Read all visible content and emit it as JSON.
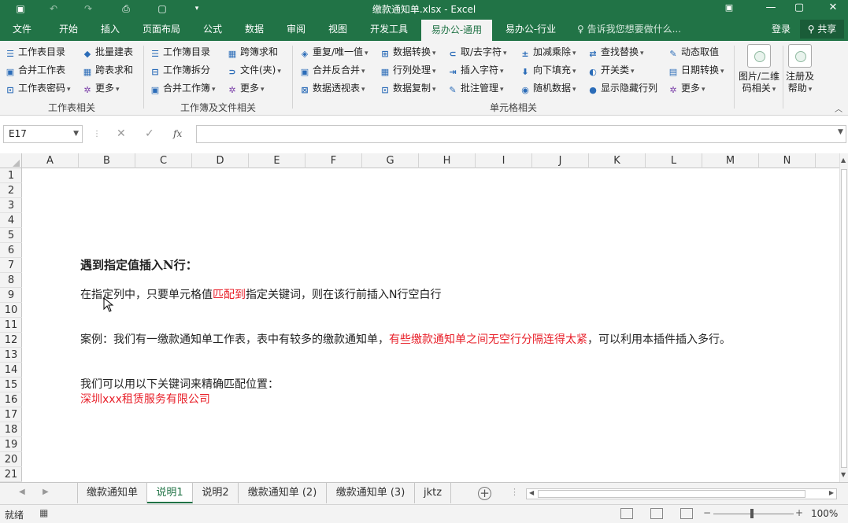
{
  "window": {
    "title": "缴款通知单.xlsx - Excel"
  },
  "tabs": [
    {
      "label": "文件"
    },
    {
      "label": "开始"
    },
    {
      "label": "插入"
    },
    {
      "label": "页面布局"
    },
    {
      "label": "公式"
    },
    {
      "label": "数据"
    },
    {
      "label": "审阅"
    },
    {
      "label": "视图"
    },
    {
      "label": "开发工具"
    },
    {
      "label": "易办公-通用"
    },
    {
      "label": "易办公-行业"
    }
  ],
  "tell_me": "告诉我您想要做什么...",
  "account": {
    "login": "登录",
    "share": "共享"
  },
  "ribbon": {
    "groups": {
      "sheet": "工作表相关",
      "workbook": "工作簿及文件相关",
      "cell": "单元格相关"
    },
    "b": {
      "sheet_list": "工作表目录",
      "batch_create": "批量建表",
      "merge_sheet": "合并工作表",
      "cross_sum": "跨表求和",
      "sheet_pwd": "工作表密码",
      "more1": "更多",
      "wb_list": "工作簿目录",
      "wb_cross_sum": "跨簿求和",
      "wb_split": "工作簿拆分",
      "file_folder": "文件(夹)",
      "merge_wb": "合并工作簿",
      "more2": "更多",
      "dup_unique": "重复/唯一值",
      "data_convert": "数据转换",
      "get_remove_char": "取/去字符",
      "add_sub_mul_div": "加减乘除",
      "find_replace": "查找替换",
      "dynamic_value": "动态取值",
      "merge_unmerge": "合并反合并",
      "row_col": "行列处理",
      "insert_char": "插入字符",
      "fill_down": "向下填充",
      "switch": "开关类",
      "date_convert": "日期转换",
      "pivot": "数据透视表",
      "data_copy": "数据复制",
      "comment_mgr": "批注管理",
      "random_data": "随机数据",
      "show_hidden_rows": "显示隐藏行列",
      "more3": "更多",
      "qr_line1": "图片/二维",
      "qr_line2": "码相关",
      "reg_line1": "注册及",
      "reg_line2": "帮助"
    }
  },
  "formula_bar": {
    "name_box": "E17",
    "cancel": "✕",
    "confirm": "✓",
    "fx": "fx",
    "formula": ""
  },
  "columns": [
    "A",
    "B",
    "C",
    "D",
    "E",
    "F",
    "G",
    "H",
    "I",
    "J",
    "K",
    "L",
    "M",
    "N"
  ],
  "rows": [
    "1",
    "2",
    "3",
    "4",
    "5",
    "6",
    "7",
    "8",
    "9",
    "10",
    "11",
    "12",
    "13",
    "14",
    "15",
    "16",
    "17",
    "18",
    "19",
    "20",
    "21"
  ],
  "content": {
    "heading": "遇到指定值插入N行：",
    "line9_a": "在指定列中，只要单元格值",
    "line9_b": "匹配到",
    "line9_c": "指定关键词，则在该行前插入N行空白行",
    "line12_a": "案例：我们有一缴款通知单工作表，表中有较多的缴款通知单，",
    "line12_b": "有些缴款通知单之间无空行分隔连得太紧",
    "line12_c": "，可以利用本插件插入多行。",
    "line15": "我们可以用以下关键词来精确匹配位置：",
    "line16": "深圳xxx租赁服务有限公司"
  },
  "sheets": [
    {
      "label": "缴款通知单"
    },
    {
      "label": "说明1"
    },
    {
      "label": "说明2"
    },
    {
      "label": "缴款通知单 (2)"
    },
    {
      "label": "缴款通知单 (3)"
    },
    {
      "label": "jktz"
    }
  ],
  "status": {
    "ready": "就绪",
    "zoom": "100%"
  },
  "colors": {
    "accent": "#217346",
    "highlight_red": "#e8202a"
  }
}
